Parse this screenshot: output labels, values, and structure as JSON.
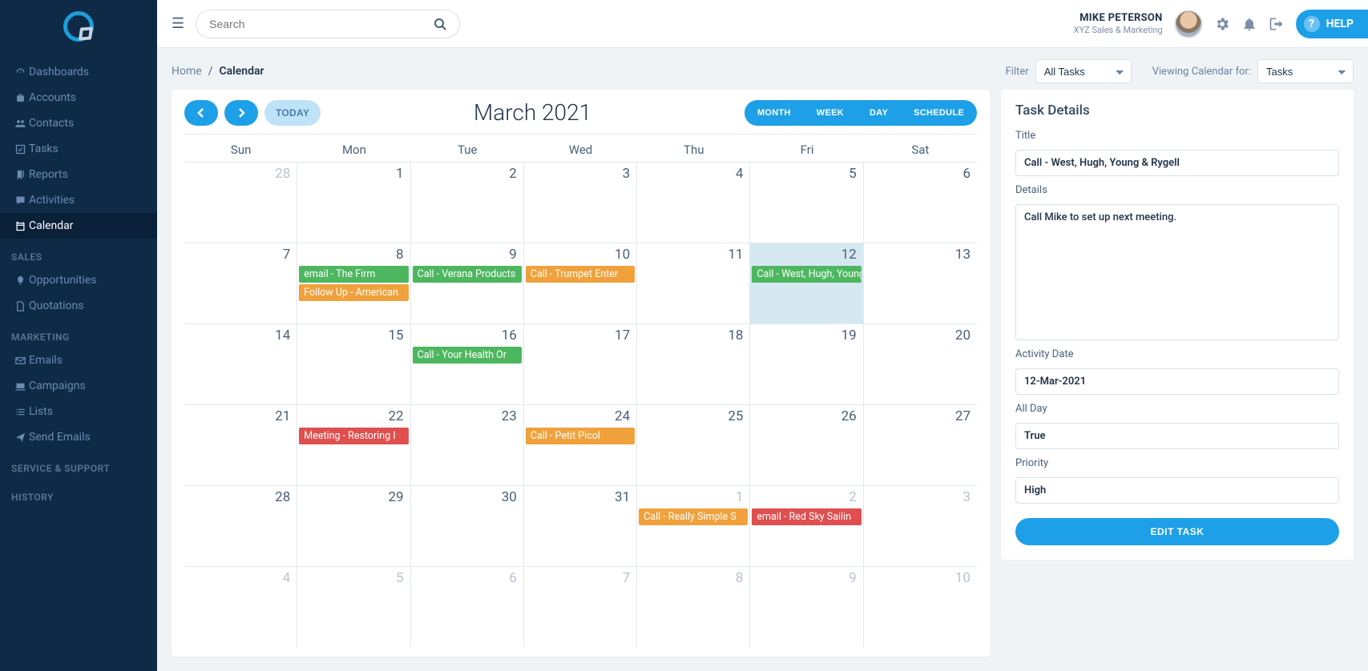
{
  "user": {
    "name": "MIKE PETERSON",
    "org": "XYZ Sales & Marketing"
  },
  "search": {
    "placeholder": "Search"
  },
  "help_label": "HELP",
  "breadcrumb": {
    "home": "Home",
    "current": "Calendar"
  },
  "filters": {
    "filter_label": "Filter",
    "filter_value": "All Tasks",
    "viewing_label": "Viewing Calendar for:",
    "viewing_value": "Tasks"
  },
  "sidebar_main": [
    {
      "icon": "tachometer",
      "label": "Dashboards"
    },
    {
      "icon": "briefcase",
      "label": "Accounts"
    },
    {
      "icon": "users",
      "label": "Contacts"
    },
    {
      "icon": "check",
      "label": "Tasks"
    },
    {
      "icon": "bookmark",
      "label": "Reports"
    },
    {
      "icon": "comment",
      "label": "Activities"
    },
    {
      "icon": "calendar",
      "label": "Calendar"
    }
  ],
  "sidebar_sections": [
    {
      "header": "SALES",
      "items": [
        {
          "icon": "lightbulb",
          "label": "Opportunities"
        },
        {
          "icon": "file",
          "label": "Quotations"
        }
      ]
    },
    {
      "header": "MARKETING",
      "items": [
        {
          "icon": "envelope",
          "label": "Emails"
        },
        {
          "icon": "laptop",
          "label": "Campaigns"
        },
        {
          "icon": "list",
          "label": "Lists"
        },
        {
          "icon": "paperplane",
          "label": "Send Emails"
        }
      ]
    },
    {
      "header": "SERVICE & SUPPORT",
      "items": []
    },
    {
      "header": "HISTORY",
      "items": []
    }
  ],
  "calendar": {
    "title": "March 2021",
    "today_label": "TODAY",
    "views": [
      "MONTH",
      "WEEK",
      "DAY",
      "SCHEDULE"
    ],
    "days_of_week": [
      "Sun",
      "Mon",
      "Tue",
      "Wed",
      "Thu",
      "Fri",
      "Sat"
    ],
    "weeks": [
      [
        {
          "num": "28",
          "other": true,
          "events": []
        },
        {
          "num": "1",
          "events": []
        },
        {
          "num": "2",
          "events": []
        },
        {
          "num": "3",
          "events": []
        },
        {
          "num": "4",
          "events": []
        },
        {
          "num": "5",
          "events": []
        },
        {
          "num": "6",
          "events": []
        }
      ],
      [
        {
          "num": "7",
          "events": []
        },
        {
          "num": "8",
          "events": [
            {
              "label": "email - The Firm",
              "color": "green"
            },
            {
              "label": "Follow Up - American",
              "color": "orange"
            }
          ]
        },
        {
          "num": "9",
          "events": [
            {
              "label": "Call - Verana Products",
              "color": "green"
            }
          ]
        },
        {
          "num": "10",
          "events": [
            {
              "label": "Call - Trumpet Enter",
              "color": "orange"
            }
          ]
        },
        {
          "num": "11",
          "events": []
        },
        {
          "num": "12",
          "selected": true,
          "events": [
            {
              "label": "Call - West, Hugh, Young",
              "color": "green"
            }
          ]
        },
        {
          "num": "13",
          "events": []
        }
      ],
      [
        {
          "num": "14",
          "events": []
        },
        {
          "num": "15",
          "events": []
        },
        {
          "num": "16",
          "events": [
            {
              "label": "Call - Your Health Or",
              "color": "green"
            }
          ]
        },
        {
          "num": "17",
          "events": []
        },
        {
          "num": "18",
          "events": []
        },
        {
          "num": "19",
          "events": []
        },
        {
          "num": "20",
          "events": []
        }
      ],
      [
        {
          "num": "21",
          "events": []
        },
        {
          "num": "22",
          "events": [
            {
              "label": "Meeting - Restoring I",
              "color": "red"
            }
          ]
        },
        {
          "num": "23",
          "events": []
        },
        {
          "num": "24",
          "events": [
            {
              "label": "Call - Petit Picol",
              "color": "orange"
            }
          ]
        },
        {
          "num": "25",
          "events": []
        },
        {
          "num": "26",
          "events": []
        },
        {
          "num": "27",
          "events": []
        }
      ],
      [
        {
          "num": "28",
          "events": []
        },
        {
          "num": "29",
          "events": []
        },
        {
          "num": "30",
          "events": []
        },
        {
          "num": "31",
          "events": []
        },
        {
          "num": "1",
          "other": true,
          "events": [
            {
              "label": "Call - Really Simple S",
              "color": "orange"
            }
          ]
        },
        {
          "num": "2",
          "other": true,
          "events": [
            {
              "label": "email - Red Sky Sailin",
              "color": "red"
            }
          ]
        },
        {
          "num": "3",
          "other": true,
          "events": []
        }
      ],
      [
        {
          "num": "4",
          "other": true,
          "events": []
        },
        {
          "num": "5",
          "other": true,
          "events": []
        },
        {
          "num": "6",
          "other": true,
          "events": []
        },
        {
          "num": "7",
          "other": true,
          "events": []
        },
        {
          "num": "8",
          "other": true,
          "events": []
        },
        {
          "num": "9",
          "other": true,
          "events": []
        },
        {
          "num": "10",
          "other": true,
          "events": []
        }
      ]
    ]
  },
  "task_panel": {
    "heading": "Task Details",
    "title_label": "Title",
    "title_value": "Call - West, Hugh, Young & Rygell",
    "details_label": "Details",
    "details_value": "Call Mike to set up next meeting.",
    "date_label": "Activity Date",
    "date_value": "12-Mar-2021",
    "allday_label": "All Day",
    "allday_value": "True",
    "priority_label": "Priority",
    "priority_value": "High",
    "edit_label": "EDIT TASK"
  }
}
